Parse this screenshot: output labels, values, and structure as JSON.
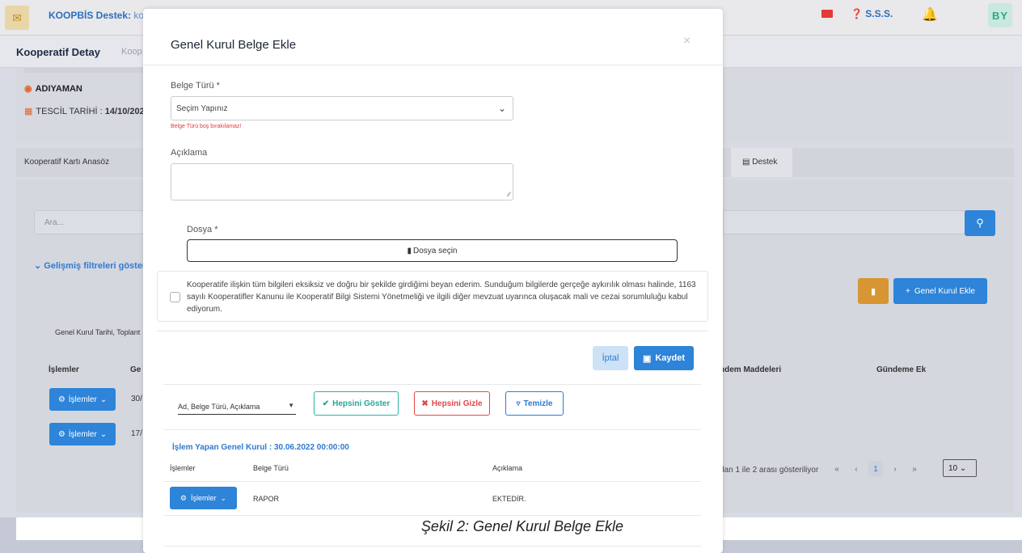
{
  "topbar": {
    "support_label": "KOOPBİS Destek:",
    "support_value": "koop",
    "faq_label": "S.S.S.",
    "user_initials": "BY"
  },
  "subbar": {
    "title": "Kooperatif Detay",
    "crumb": "Koop"
  },
  "info": {
    "location": "ADIYAMAN",
    "registration_label": "TESCİL TARİHİ :",
    "registration_value": "14/10/202"
  },
  "tabs": {
    "left": "Kooperatif Kartı   Anasöz",
    "support": "Destek"
  },
  "list": {
    "search_placeholder": "Ara...",
    "advanced_filters": "Gelişmiş filtreleri göster",
    "add_button": "Genel Kurul Ekle",
    "columns_select": "Genel Kurul Tarihi, Toplant",
    "headers": [
      "İşlemler",
      "Ge",
      "ndem Maddeleri",
      "Gündeme Ek"
    ],
    "rows": [
      {
        "action": "İşlemler",
        "date": "30/"
      },
      {
        "action": "İşlemler",
        "date": "17/"
      }
    ],
    "pager_info": "dan 1 ile 2 arası gösteriliyor",
    "pager": {
      "first": "«",
      "prev": "‹",
      "page": "1",
      "next": "›",
      "last": "»"
    },
    "page_size": "10"
  },
  "modal": {
    "title": "Genel Kurul Belge Ekle",
    "close": "×",
    "doc_type_label": "Belge Türü *",
    "doc_type_value": "Seçim Yapınız",
    "doc_type_error": "Belge Türü boş bırakılamaz!",
    "description_label": "Açıklama",
    "file_label": "Dosya *",
    "file_button": "Dosya seçin",
    "declaration": "Kooperatife ilişkin tüm bilgileri eksiksiz ve doğru bir şekilde girdiğimi beyan ederim. Sunduğum bilgilerde gerçeğe aykırılık olması halinde, 1163 sayılı Kooperatifler Kanunu ile Kooperatif Bilgi Sistemi Yönetmeliği ve ilgili diğer mevzuat uyarınca oluşacak mali ve cezai sorumluluğu kabul ediyorum.",
    "cancel": "İptal",
    "save": "Kaydet",
    "columns_select": "Ad, Belge Türü, Açıklama",
    "show_all": "Hepsini Göster",
    "hide_all": "Hepsini Gizle",
    "clear": "Temizle",
    "proc_title": "İşlem Yapan Genel Kurul : 30.06.2022 00:00:00",
    "table_headers": [
      "İşlemler",
      "Belge Türü",
      "Açıklama"
    ],
    "table_rows": [
      {
        "action": "İşlemler",
        "type": "RAPOR",
        "description": "EKTEDİR."
      }
    ]
  },
  "caption": "Şekil 2: Genel Kurul Belge Ekle",
  "colors": {
    "primary": "#2d84d8",
    "danger": "#e53935",
    "teal": "#2bb3a2",
    "orange": "#d79633"
  }
}
